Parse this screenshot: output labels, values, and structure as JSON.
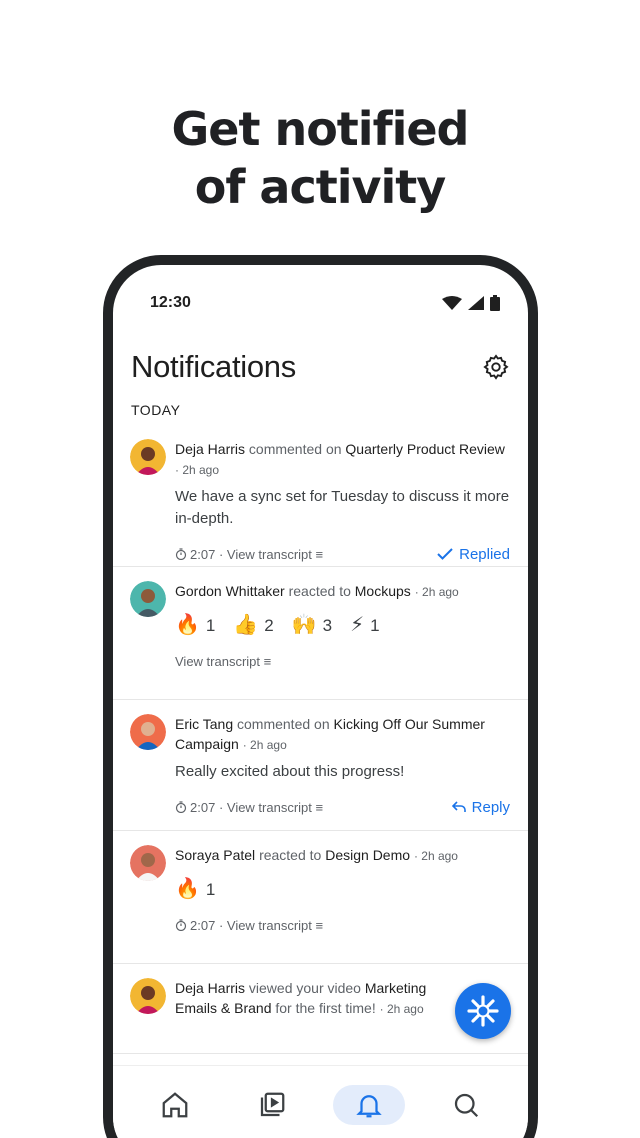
{
  "headline": {
    "line1": "Get notified",
    "line2": "of activity"
  },
  "status": {
    "time": "12:30"
  },
  "header": {
    "title": "Notifications"
  },
  "section": "TODAY",
  "notifications": [
    {
      "name": "Deja Harris",
      "verb": "commented on",
      "target": "Quarterly Product Review",
      "ago": "· 2h ago",
      "body": "We have a sync set for Tuesday to discuss it more in-depth.",
      "duration": "2:07",
      "transcript": "· View transcript",
      "action": "Replied"
    },
    {
      "name": "Gordon Whittaker",
      "verb": "reacted to",
      "target": "Mockups",
      "ago": "· 2h ago",
      "reactions": [
        {
          "emoji": "🔥",
          "count": "1"
        },
        {
          "emoji": "👍",
          "count": "2"
        },
        {
          "emoji": "🙌",
          "count": "3"
        },
        {
          "emoji": "⚡",
          "count": "1"
        }
      ],
      "transcript": "View transcript"
    },
    {
      "name": "Eric Tang",
      "verb": "commented on",
      "target": "Kicking Off Our Summer Campaign",
      "ago": "· 2h ago",
      "body": "Really excited about this progress!",
      "duration": "2:07",
      "transcript": "· View transcript",
      "action": "Reply"
    },
    {
      "name": "Soraya Patel",
      "verb": "reacted to",
      "target": "Design Demo",
      "ago": "· 2h ago",
      "reactions": [
        {
          "emoji": "🔥",
          "count": "1"
        }
      ],
      "duration": "2:07",
      "transcript": "· View transcript"
    },
    {
      "name": "Deja Harris",
      "verb": "viewed your video",
      "target": "Marketing Emails & Brand",
      "suffix": "for the first time!",
      "ago": "· 2h ago"
    }
  ],
  "colors": {
    "accent": "#1a73e8",
    "frame": "#222426"
  }
}
